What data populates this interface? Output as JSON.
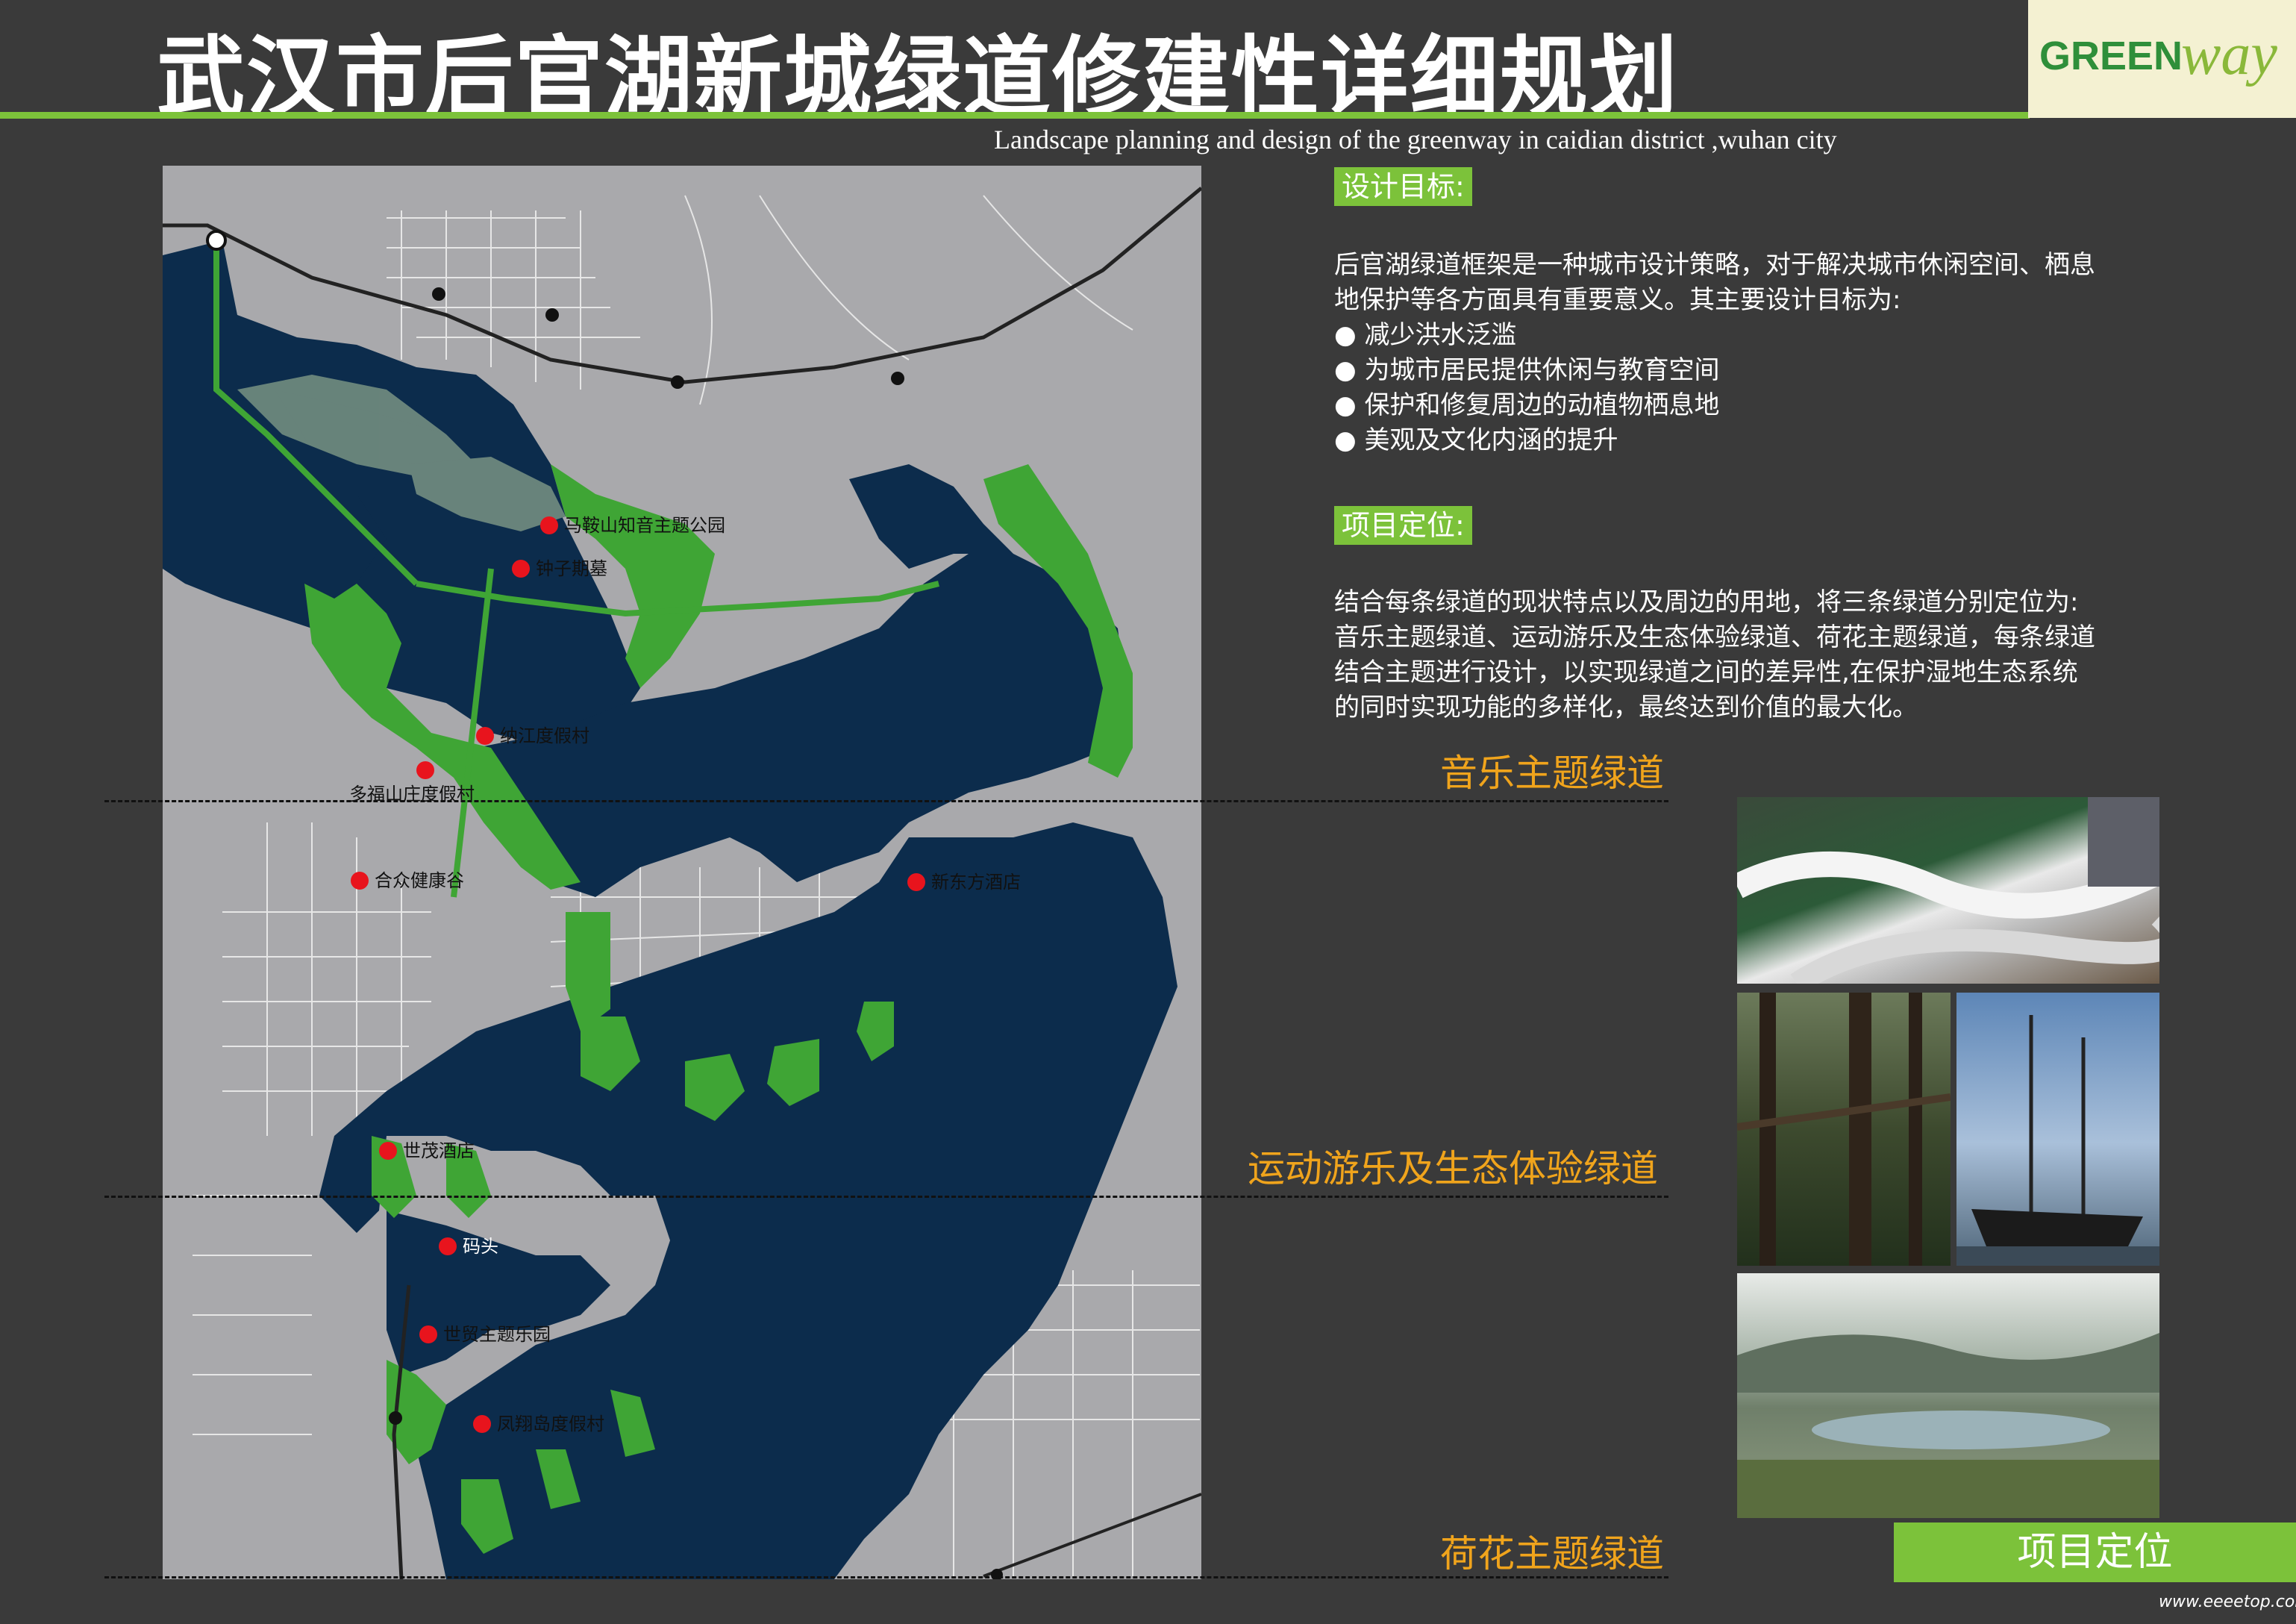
{
  "header": {
    "title": "武汉市后官湖新城绿道修建性详细规划",
    "subtitle": "Landscape planning and design of the greenway in caidian district ,wuhan city",
    "logo_text_green": "GREEN",
    "logo_text_way": "way"
  },
  "design_goals": {
    "heading": "设计目标:",
    "intro": [
      "后官湖绿道框架是一种城市设计策略，对于解决城市休闲空间、栖息",
      "地保护等各方面具有重要意义。其主要设计目标为:"
    ],
    "bullets": [
      "减少洪水泛滥",
      "为城市居民提供休闲与教育空间",
      "保护和修复周边的动植物栖息地",
      "美观及文化内涵的提升"
    ]
  },
  "positioning": {
    "heading": "项目定位:",
    "lines": [
      "结合每条绿道的现状特点以及周边的用地，将三条绿道分别定位为:",
      "音乐主题绿道、运动游乐及生态体验绿道、荷花主题绿道，每条绿道",
      "结合主题进行设计，以实现绿道之间的差异性,在保护湿地生态系统",
      "的同时实现功能的多样化，最终达到价值的最大化。"
    ]
  },
  "zones": {
    "music": "音乐主题绿道",
    "sport": "运动游乐及生态体验绿道",
    "lotus": "荷花主题绿道"
  },
  "map_labels": {
    "maanshan": "马鞍山知音主题公园",
    "zhongziqi": "钟子期墓",
    "duboshan": "纳江度假村",
    "dufushan": "多福山庄度假村",
    "hezhong": "合众健康谷",
    "xindongfang": "新东方酒店",
    "shimao_hotel": "世茂酒店",
    "matou": "码头",
    "shimao_park": "世贸主题乐园",
    "fengxiang": "凤翔岛度假村"
  },
  "badge": "项目定位",
  "watermark": "www.eeeetop.com",
  "colors": {
    "background": "#3a3a3a",
    "accent_green": "#7cc23a",
    "zone_orange": "#f0a41c",
    "water": "#0c2c4c",
    "land": "#a9a9ac",
    "greenway": "#3fa535"
  }
}
